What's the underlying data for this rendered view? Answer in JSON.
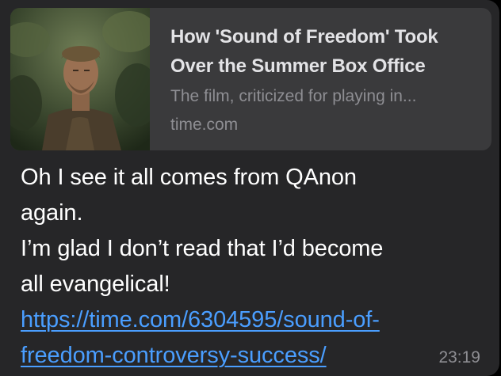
{
  "link_preview": {
    "image": "movie-still-man-in-jungle",
    "title_line_1": "How 'Sound of Freedom' Took",
    "title_line_2": "Over the Summer Box Office",
    "description": "The film, criticized for playing in...",
    "domain": "time.com"
  },
  "message": {
    "line_1": "Oh I see it all comes from QAnon",
    "line_2": "again.",
    "line_3": "I’m glad I don’t read that I’d become",
    "line_4": "all evangelical!",
    "link_line_1": "https://time.com/6304595/sound-of-",
    "link_line_2": "freedom-controversy-success/",
    "timestamp": "23:19"
  },
  "colors": {
    "background": "#000000",
    "bubble": "#262628",
    "preview_card": "#3a3a3c",
    "link": "#4a9eff",
    "secondary_text": "#8e8e93"
  }
}
